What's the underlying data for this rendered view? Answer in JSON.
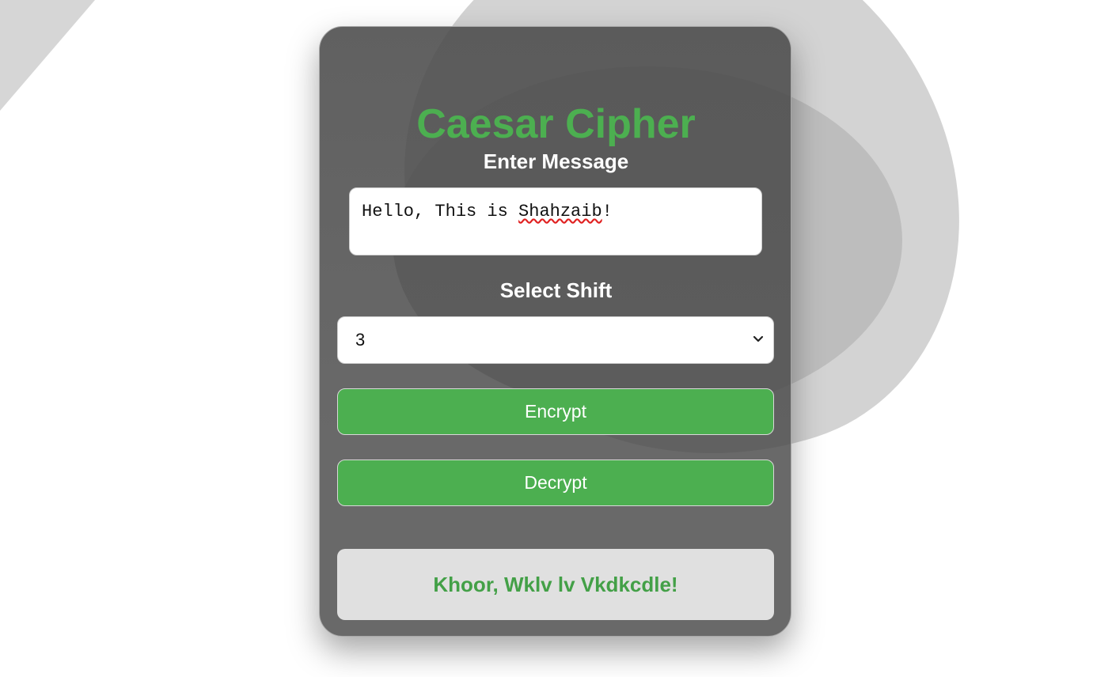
{
  "app": {
    "title": "Caesar Cipher"
  },
  "form": {
    "message_label": "Enter Message",
    "message_value_prefix": "Hello, This is ",
    "message_value_misspelled": "Shahzaib",
    "message_value_suffix": "!",
    "shift_label": "Select Shift",
    "shift_selected": "3"
  },
  "actions": {
    "encrypt_label": "Encrypt",
    "decrypt_label": "Decrypt"
  },
  "result": {
    "text": "Khoor, Wklv lv Vkdkcdle!"
  },
  "colors": {
    "accent": "#4caf50",
    "result_text": "#43a047",
    "card_bg": "#4a4a4a",
    "result_bg": "#e0e0e0"
  },
  "icons": {
    "select_arrow": "chevron-down-icon"
  }
}
